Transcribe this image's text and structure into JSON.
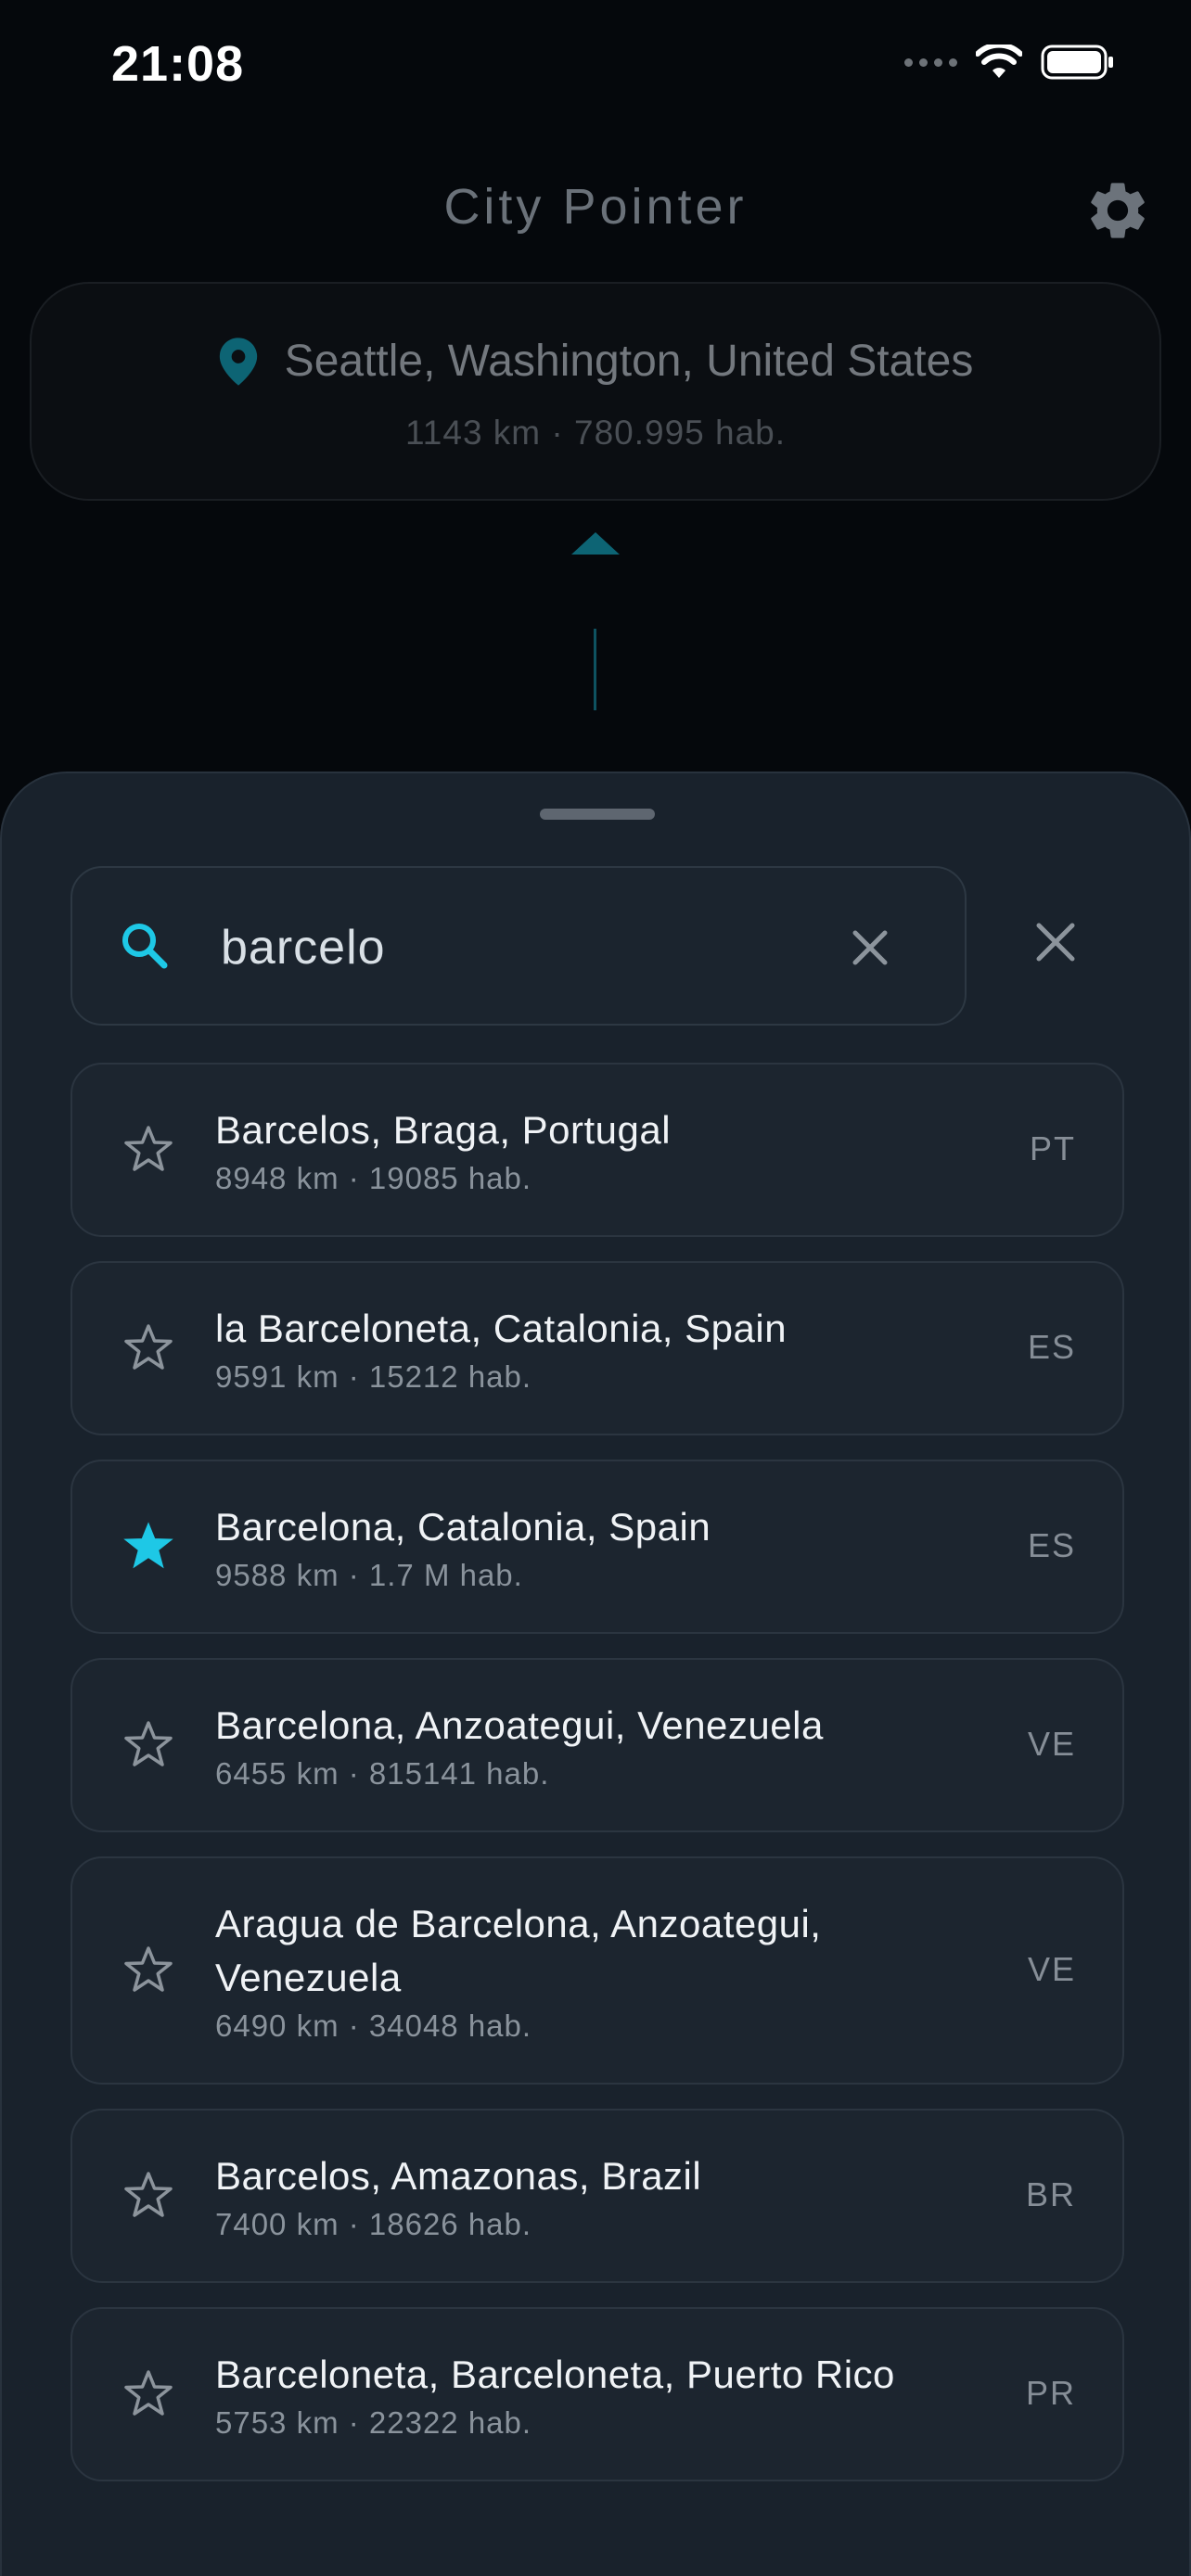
{
  "status_bar": {
    "time": "21:08"
  },
  "header": {
    "title": "City Pointer",
    "settings_icon": "gear-icon"
  },
  "current_location": {
    "icon": "map-pin-icon",
    "name": "Seattle, Washington, United States",
    "details": "1143 km · 780.995 hab."
  },
  "colors": {
    "accent": "#1ec8e6",
    "background": "#05080c",
    "sheet": "#19222c"
  },
  "search": {
    "value": "barcelo",
    "icon": "search-icon"
  },
  "results": [
    {
      "name": "Barcelos, Braga, Portugal",
      "details": "8948 km · 19085 hab.",
      "country": "PT",
      "favorite": false
    },
    {
      "name": "la Barceloneta, Catalonia, Spain",
      "details": "9591 km · 15212 hab.",
      "country": "ES",
      "favorite": false
    },
    {
      "name": "Barcelona, Catalonia, Spain",
      "details": "9588 km · 1.7 M hab.",
      "country": "ES",
      "favorite": true
    },
    {
      "name": "Barcelona, Anzoategui, Venezuela",
      "details": "6455 km · 815141 hab.",
      "country": "VE",
      "favorite": false
    },
    {
      "name": "Aragua de Barcelona, Anzoategui, Venezuela",
      "details": "6490 km · 34048 hab.",
      "country": "VE",
      "favorite": false
    },
    {
      "name": "Barcelos, Amazonas, Brazil",
      "details": "7400 km · 18626 hab.",
      "country": "BR",
      "favorite": false
    },
    {
      "name": "Barceloneta, Barceloneta, Puerto Rico",
      "details": "5753 km · 22322 hab.",
      "country": "PR",
      "favorite": false
    }
  ]
}
